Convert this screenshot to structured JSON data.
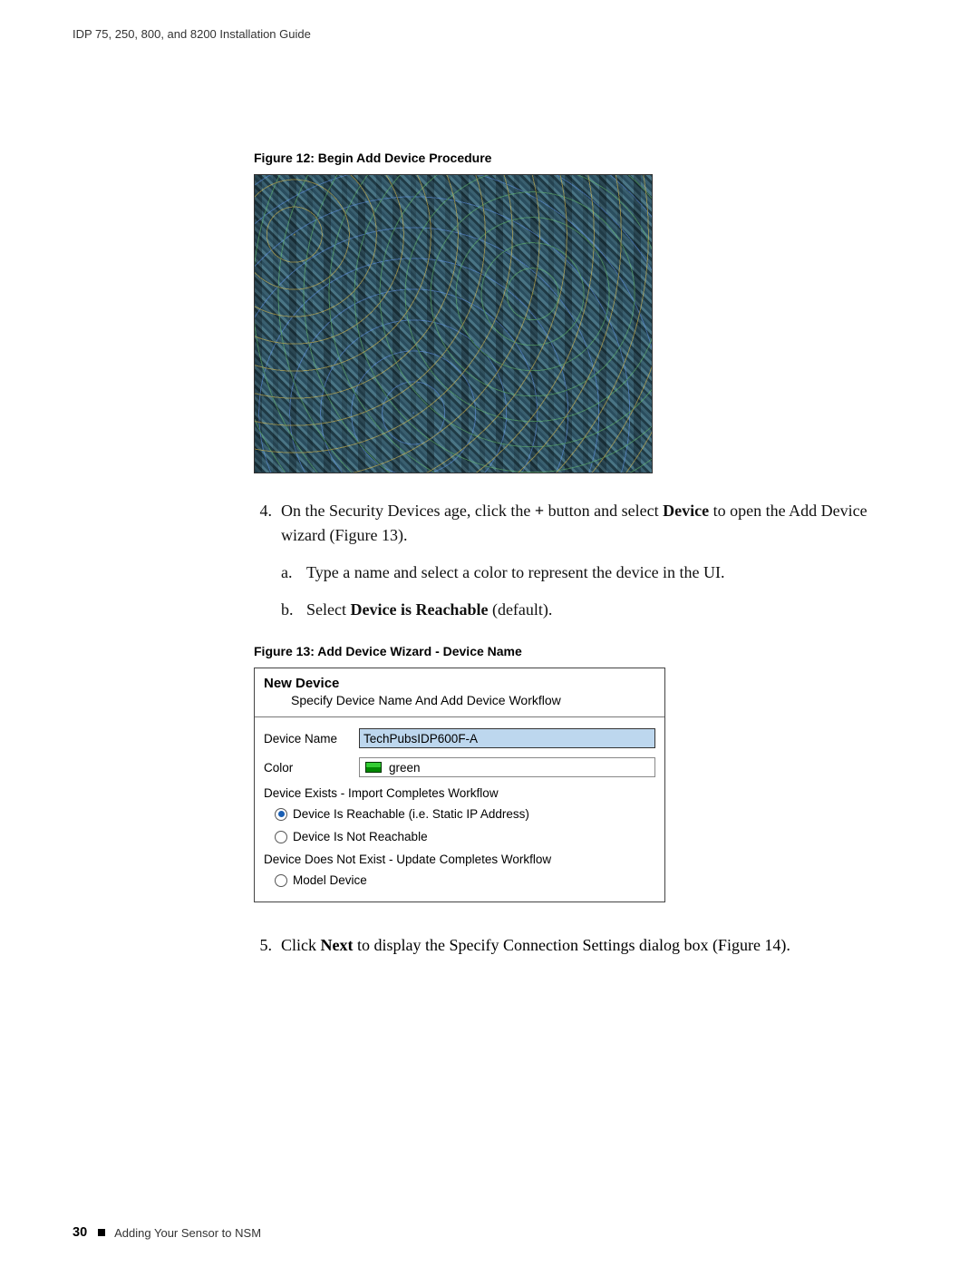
{
  "header": {
    "doc_title": "IDP 75, 250, 800, and 8200 Installation Guide"
  },
  "figures": {
    "fig12_caption": "Figure 12:  Begin Add Device Procedure",
    "fig13_caption": "Figure 13:  Add Device Wizard - Device Name"
  },
  "step4": {
    "num": "4.",
    "pre": "On the Security Devices age, click the  ",
    "plus": "+",
    "mid": " button and select ",
    "bold1": "Device",
    "post": " to open the Add Device wizard (Figure 13).",
    "a": {
      "letter": "a.",
      "text": "Type a name and select a color to represent the device in the UI."
    },
    "b": {
      "letter": "b.",
      "pre": "Select ",
      "bold": "Device is Reachable",
      "post": " (default)."
    }
  },
  "dialog": {
    "title": "New Device",
    "subtitle": "Specify Device Name And Add Device Workflow",
    "device_name_label": "Device Name",
    "device_name_value": "TechPubsIDP600F-A",
    "color_label": "Color",
    "color_value": "green",
    "section_exists": "Device Exists - Import Completes Workflow",
    "radio_reachable": "Device Is Reachable (i.e. Static IP Address)",
    "radio_not_reachable": "Device Is Not Reachable",
    "section_notexist": "Device Does Not Exist - Update Completes Workflow",
    "radio_model": "Model Device"
  },
  "step5": {
    "num": "5.",
    "pre": "Click ",
    "bold": "Next",
    "post": " to display the Specify Connection Settings dialog box (Figure 14)."
  },
  "footer": {
    "page_number": "30",
    "section": "Adding Your Sensor to NSM"
  }
}
